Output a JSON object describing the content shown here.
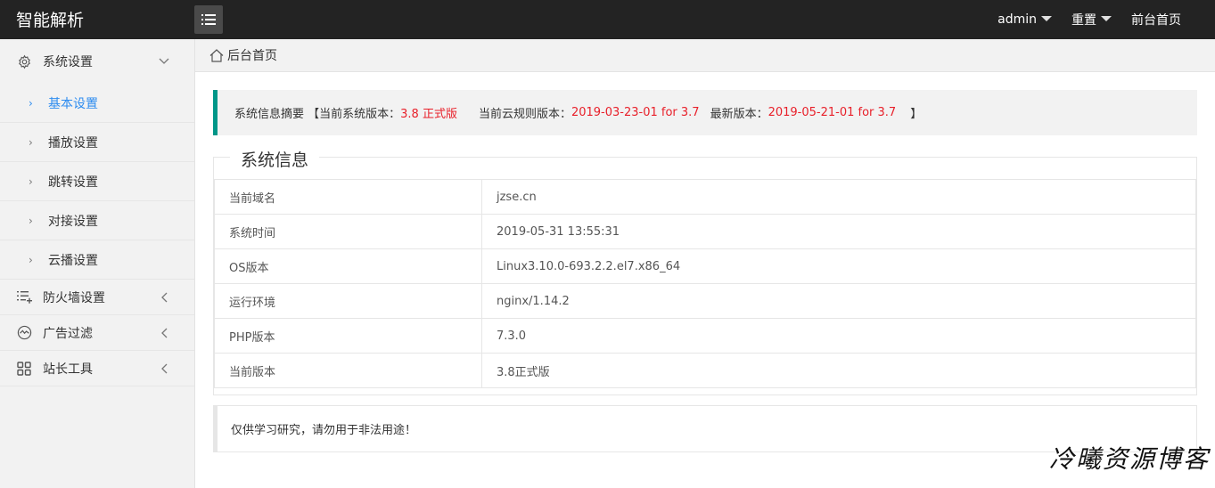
{
  "header": {
    "logo": "智能解析",
    "nav": [
      {
        "label": "admin",
        "dropdown": true
      },
      {
        "label": "重置",
        "dropdown": true
      },
      {
        "label": "前台首页",
        "dropdown": false
      }
    ]
  },
  "sidebar": {
    "groups": [
      {
        "label": "系统设置",
        "icon": "gear-icon",
        "expanded": true
      },
      {
        "label": "防火墙设置",
        "icon": "list-add-icon",
        "expanded": false
      },
      {
        "label": "广告过滤",
        "icon": "chart-circle-icon",
        "expanded": false
      },
      {
        "label": "站长工具",
        "icon": "grid-icon",
        "expanded": false
      }
    ],
    "sub_items": [
      {
        "label": "基本设置",
        "active": true
      },
      {
        "label": "播放设置"
      },
      {
        "label": "跳转设置"
      },
      {
        "label": "对接设置"
      },
      {
        "label": "云播设置"
      }
    ]
  },
  "breadcrumb": {
    "label": "后台首页"
  },
  "notice": {
    "prefix": "系统信息摘要 【当前系统版本：",
    "sys_version": "3.8 正式版",
    "cloud_label": "当前云规则版本：",
    "cloud_version": "2019-03-23-01 for 3.7",
    "latest_label": "最新版本：",
    "latest_version": "2019-05-21-01 for 3.7",
    "suffix": "】"
  },
  "info": {
    "title": "系统信息",
    "rows": [
      {
        "key": "当前域名",
        "value": "jzse.cn"
      },
      {
        "key": "系统时间",
        "value": "2019-05-31 13:55:31"
      },
      {
        "key": "OS版本",
        "value": "Linux3.10.0-693.2.2.el7.x86_64"
      },
      {
        "key": "运行环境",
        "value": "nginx/1.14.2"
      },
      {
        "key": "PHP版本",
        "value": "7.3.0"
      },
      {
        "key": "当前版本",
        "value": "3.8正式版"
      }
    ]
  },
  "disclaimer": "仅供学习研究，请勿用于非法用途！",
  "watermark": "冷曦资源博客",
  "colors": {
    "accent": "#009688",
    "active": "#2d8cf0",
    "highlight": "#e8202a",
    "header": "#232323"
  }
}
